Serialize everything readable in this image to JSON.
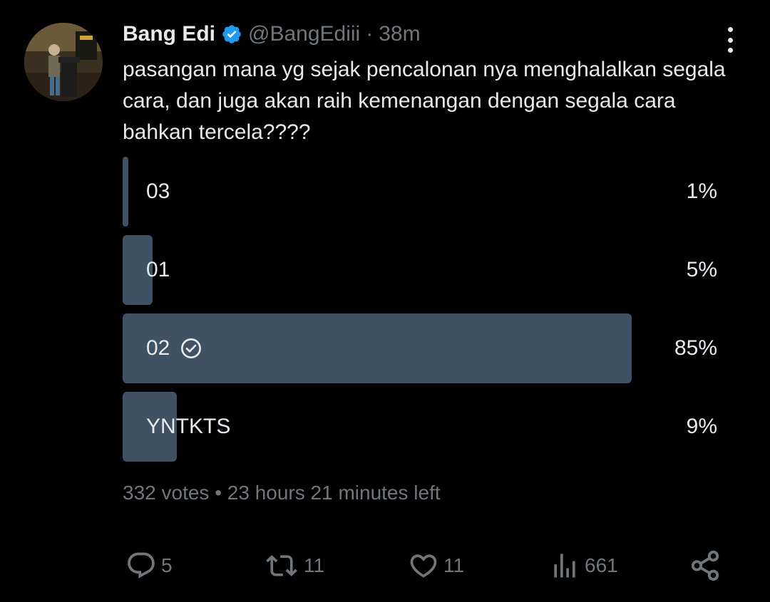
{
  "user": {
    "display_name": "Bang Edi",
    "handle": "@BangEdiii",
    "separator": "·",
    "time": "38m",
    "verified": true
  },
  "tweet": {
    "text": "pasangan mana yg sejak pencalonan nya menghalalkan segala cara, dan juga akan raih kemenangan dengan segala cara bahkan tercela????"
  },
  "poll": {
    "options": [
      {
        "label": "03",
        "percent_text": "1%",
        "percent": 1,
        "selected": false
      },
      {
        "label": "01",
        "percent_text": "5%",
        "percent": 5,
        "selected": false
      },
      {
        "label": "02",
        "percent_text": "85%",
        "percent": 85,
        "selected": true
      },
      {
        "label": "YNTKTS",
        "percent_text": "9%",
        "percent": 9,
        "selected": false
      }
    ],
    "meta": "332 votes • 23 hours 21 minutes left"
  },
  "actions": {
    "reply_count": "5",
    "retweet_count": "11",
    "like_count": "11",
    "views_count": "661"
  },
  "icons": {
    "more": "more-vertical-icon",
    "verified": "verified-badge-icon",
    "reply": "reply-icon",
    "retweet": "retweet-icon",
    "like": "heart-icon",
    "views": "views-chart-icon",
    "share": "share-icon",
    "check": "check-circle-icon"
  },
  "colors": {
    "background": "#000000",
    "text": "#e7e9ea",
    "muted": "#71767b",
    "poll_bar": "#3e5263",
    "verified": "#1d9bf0"
  }
}
